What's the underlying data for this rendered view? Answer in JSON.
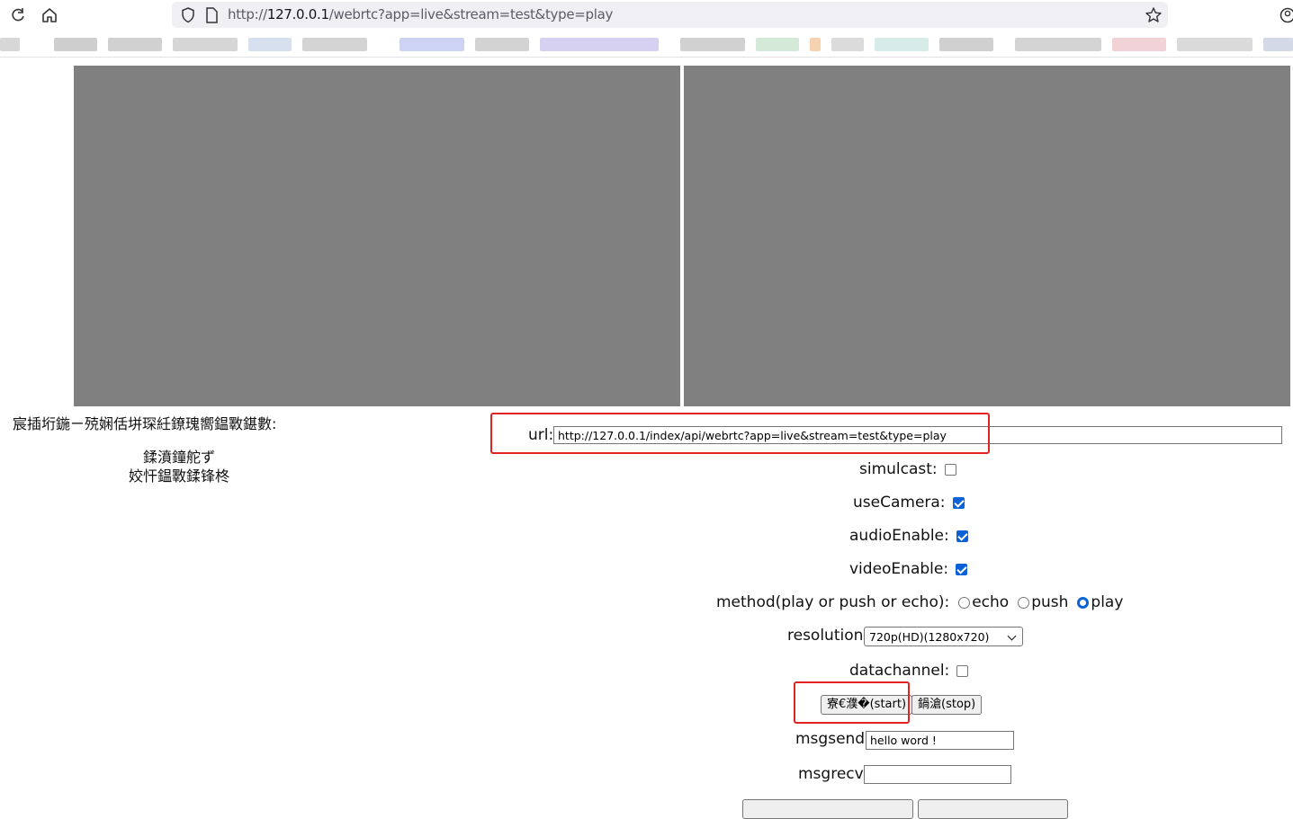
{
  "browser": {
    "url_prefix": "http://",
    "url_host": "127.0.0.1",
    "url_path": "/webrtc?app=live&stream=test&type=play"
  },
  "status": {
    "line1": "宸插垳鍦ㄧ殑娴佸垪琛紝鐐瑰嚮鎾斁鍖數:",
    "line2": "鍒濆鐘舵ず",
    "line3": "姣忓鎾斁鍒锋柊"
  },
  "form": {
    "url_label": "url:",
    "url_value": "http://127.0.0.1/index/api/webrtc?app=live&stream=test&type=play",
    "simulcast_label": "simulcast:",
    "simulcast_checked": false,
    "usecamera_label": "useCamera:",
    "usecamera_checked": true,
    "audio_label": "audioEnable:",
    "audio_checked": true,
    "video_label": "videoEnable:",
    "video_checked": true,
    "method_label": "method(play or push or echo):",
    "method_options": [
      "echo",
      "push",
      "play"
    ],
    "method_selected": "play",
    "resolution_label": "resolution:",
    "resolution_value": "720p(HD)(1280x720)",
    "datachannel_label": "datachannel:",
    "datachannel_checked": false,
    "start_label": "寮€濮�(start)",
    "stop_label": "鍋滄(stop)",
    "msgsend_label": "msgsend:",
    "msgsend_value": "hello word !",
    "msgrecv_label": "msgrecv:",
    "msgrecv_value": ""
  },
  "colors": {
    "video_bg": "#808080",
    "highlight": "#e32222",
    "checkbox_accent": "#0b62d8"
  }
}
